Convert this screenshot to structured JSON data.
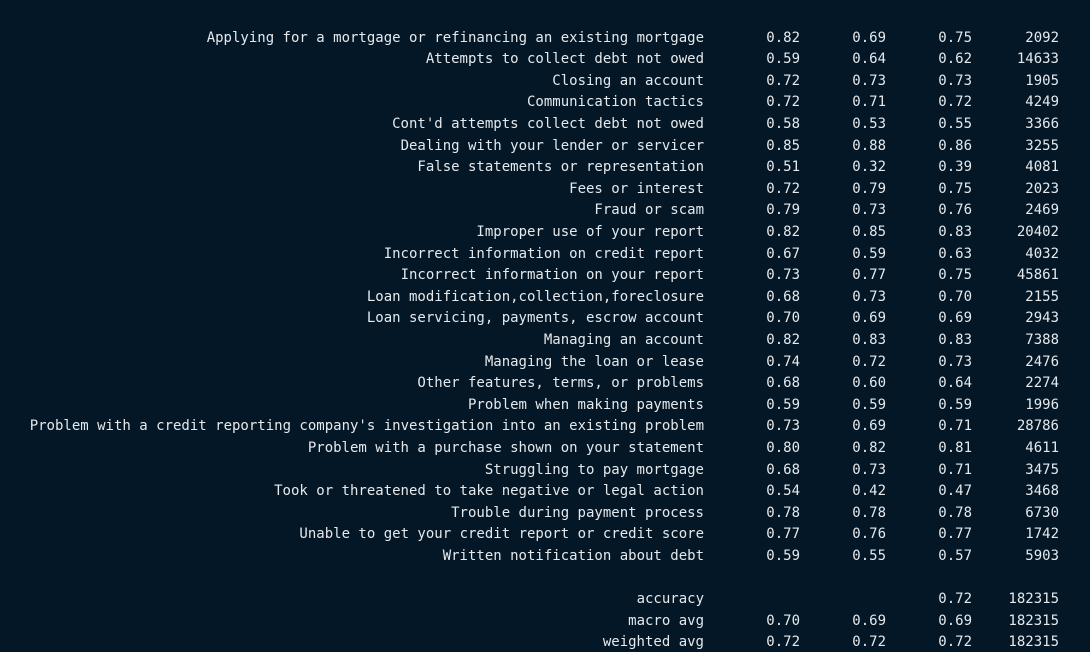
{
  "rows": [
    {
      "label": "Applying for a mortgage or refinancing an existing mortgage",
      "precision": "0.82",
      "recall": "0.69",
      "f1": "0.75",
      "support": "2092"
    },
    {
      "label": "Attempts to collect debt not owed",
      "precision": "0.59",
      "recall": "0.64",
      "f1": "0.62",
      "support": "14633"
    },
    {
      "label": "Closing an account",
      "precision": "0.72",
      "recall": "0.73",
      "f1": "0.73",
      "support": "1905"
    },
    {
      "label": "Communication tactics",
      "precision": "0.72",
      "recall": "0.71",
      "f1": "0.72",
      "support": "4249"
    },
    {
      "label": "Cont'd attempts collect debt not owed",
      "precision": "0.58",
      "recall": "0.53",
      "f1": "0.55",
      "support": "3366"
    },
    {
      "label": "Dealing with your lender or servicer",
      "precision": "0.85",
      "recall": "0.88",
      "f1": "0.86",
      "support": "3255"
    },
    {
      "label": "False statements or representation",
      "precision": "0.51",
      "recall": "0.32",
      "f1": "0.39",
      "support": "4081"
    },
    {
      "label": "Fees or interest",
      "precision": "0.72",
      "recall": "0.79",
      "f1": "0.75",
      "support": "2023"
    },
    {
      "label": "Fraud or scam",
      "precision": "0.79",
      "recall": "0.73",
      "f1": "0.76",
      "support": "2469"
    },
    {
      "label": "Improper use of your report",
      "precision": "0.82",
      "recall": "0.85",
      "f1": "0.83",
      "support": "20402"
    },
    {
      "label": "Incorrect information on credit report",
      "precision": "0.67",
      "recall": "0.59",
      "f1": "0.63",
      "support": "4032"
    },
    {
      "label": "Incorrect information on your report",
      "precision": "0.73",
      "recall": "0.77",
      "f1": "0.75",
      "support": "45861"
    },
    {
      "label": "Loan modification,collection,foreclosure",
      "precision": "0.68",
      "recall": "0.73",
      "f1": "0.70",
      "support": "2155"
    },
    {
      "label": "Loan servicing, payments, escrow account",
      "precision": "0.70",
      "recall": "0.69",
      "f1": "0.69",
      "support": "2943"
    },
    {
      "label": "Managing an account",
      "precision": "0.82",
      "recall": "0.83",
      "f1": "0.83",
      "support": "7388"
    },
    {
      "label": "Managing the loan or lease",
      "precision": "0.74",
      "recall": "0.72",
      "f1": "0.73",
      "support": "2476"
    },
    {
      "label": "Other features, terms, or problems",
      "precision": "0.68",
      "recall": "0.60",
      "f1": "0.64",
      "support": "2274"
    },
    {
      "label": "Problem when making payments",
      "precision": "0.59",
      "recall": "0.59",
      "f1": "0.59",
      "support": "1996"
    },
    {
      "label": "Problem with a credit reporting company's investigation into an existing problem",
      "precision": "0.73",
      "recall": "0.69",
      "f1": "0.71",
      "support": "28786"
    },
    {
      "label": "Problem with a purchase shown on your statement",
      "precision": "0.80",
      "recall": "0.82",
      "f1": "0.81",
      "support": "4611"
    },
    {
      "label": "Struggling to pay mortgage",
      "precision": "0.68",
      "recall": "0.73",
      "f1": "0.71",
      "support": "3475"
    },
    {
      "label": "Took or threatened to take negative or legal action",
      "precision": "0.54",
      "recall": "0.42",
      "f1": "0.47",
      "support": "3468"
    },
    {
      "label": "Trouble during payment process",
      "precision": "0.78",
      "recall": "0.78",
      "f1": "0.78",
      "support": "6730"
    },
    {
      "label": "Unable to get your credit report or credit score",
      "precision": "0.77",
      "recall": "0.76",
      "f1": "0.77",
      "support": "1742"
    },
    {
      "label": "Written notification about debt",
      "precision": "0.59",
      "recall": "0.55",
      "f1": "0.57",
      "support": "5903"
    }
  ],
  "summary": [
    {
      "label": "accuracy",
      "precision": "",
      "recall": "",
      "f1": "0.72",
      "support": "182315"
    },
    {
      "label": "macro avg",
      "precision": "0.70",
      "recall": "0.69",
      "f1": "0.69",
      "support": "182315"
    },
    {
      "label": "weighted avg",
      "precision": "0.72",
      "recall": "0.72",
      "f1": "0.72",
      "support": "182315"
    }
  ]
}
